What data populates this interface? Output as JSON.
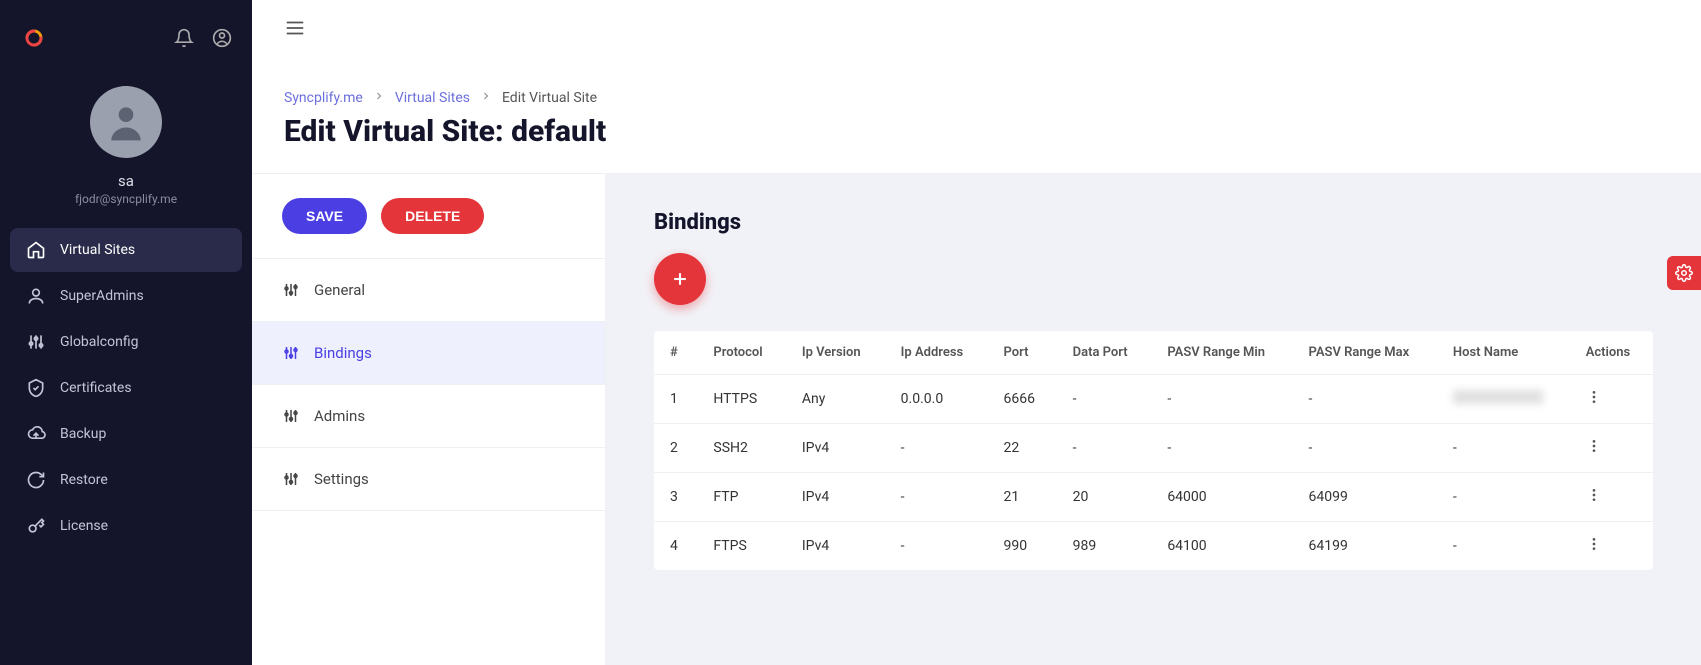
{
  "user": {
    "name": "sa",
    "email": "fjodr@syncplify.me"
  },
  "nav": {
    "items": [
      {
        "label": "Virtual Sites"
      },
      {
        "label": "SuperAdmins"
      },
      {
        "label": "Globalconfig"
      },
      {
        "label": "Certificates"
      },
      {
        "label": "Backup"
      },
      {
        "label": "Restore"
      },
      {
        "label": "License"
      }
    ]
  },
  "breadcrumbs": {
    "a": "Syncplify.me",
    "b": "Virtual Sites",
    "c": "Edit Virtual Site"
  },
  "page_title": "Edit Virtual Site: default",
  "buttons": {
    "save": "SAVE",
    "delete": "DELETE"
  },
  "subnav": {
    "items": [
      {
        "label": "General"
      },
      {
        "label": "Bindings"
      },
      {
        "label": "Admins"
      },
      {
        "label": "Settings"
      }
    ]
  },
  "section": {
    "title": "Bindings"
  },
  "table": {
    "headers": [
      "#",
      "Protocol",
      "Ip Version",
      "Ip Address",
      "Port",
      "Data Port",
      "PASV Range Min",
      "PASV Range Max",
      "Host Name",
      "Actions"
    ],
    "rows": [
      {
        "n": "1",
        "protocol": "HTTPS",
        "ipv": "Any",
        "ip": "0.0.0.0",
        "port": "6666",
        "dport": "-",
        "pmin": "-",
        "pmax": "-",
        "host": "__blur__"
      },
      {
        "n": "2",
        "protocol": "SSH2",
        "ipv": "IPv4",
        "ip": "-",
        "port": "22",
        "dport": "-",
        "pmin": "-",
        "pmax": "-",
        "host": "-"
      },
      {
        "n": "3",
        "protocol": "FTP",
        "ipv": "IPv4",
        "ip": "-",
        "port": "21",
        "dport": "20",
        "pmin": "64000",
        "pmax": "64099",
        "host": "-"
      },
      {
        "n": "4",
        "protocol": "FTPS",
        "ipv": "IPv4",
        "ip": "-",
        "port": "990",
        "dport": "989",
        "pmin": "64100",
        "pmax": "64199",
        "host": "-"
      }
    ]
  }
}
